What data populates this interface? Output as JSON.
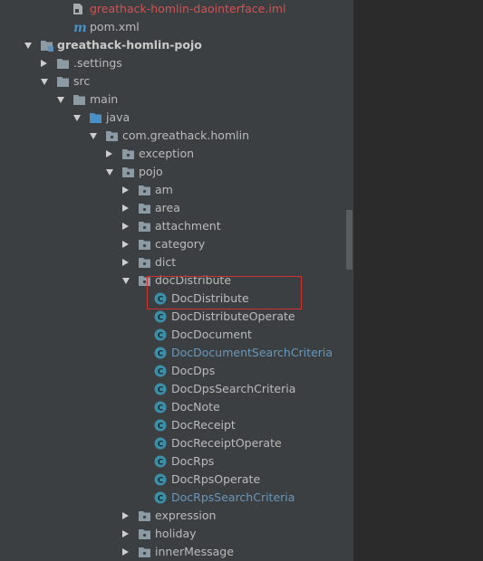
{
  "tree": {
    "rows": [
      {
        "label": "greathack-homlin-daointerface.iml",
        "icon": "iml-file-icon",
        "style": "red"
      },
      {
        "label": "pom.xml",
        "icon": "maven-icon",
        "style": "normal"
      },
      {
        "label": "greathack-homlin-pojo",
        "icon": "module-folder-icon",
        "style": "bold",
        "state": "expanded"
      },
      {
        "label": ".settings",
        "icon": "folder-icon",
        "style": "normal",
        "state": "collapsed"
      },
      {
        "label": "src",
        "icon": "folder-icon",
        "style": "normal",
        "state": "expanded"
      },
      {
        "label": "main",
        "icon": "folder-icon",
        "style": "normal",
        "state": "expanded"
      },
      {
        "label": "java",
        "icon": "source-folder-icon",
        "style": "normal",
        "state": "expanded"
      },
      {
        "label": "com.greathack.homlin",
        "icon": "package-icon",
        "style": "normal",
        "state": "expanded"
      },
      {
        "label": "exception",
        "icon": "package-icon",
        "style": "normal",
        "state": "collapsed"
      },
      {
        "label": "pojo",
        "icon": "package-icon",
        "style": "normal",
        "state": "expanded"
      },
      {
        "label": "am",
        "icon": "package-icon",
        "style": "normal",
        "state": "collapsed"
      },
      {
        "label": "area",
        "icon": "package-icon",
        "style": "normal",
        "state": "collapsed"
      },
      {
        "label": "attachment",
        "icon": "package-icon",
        "style": "normal",
        "state": "collapsed"
      },
      {
        "label": "category",
        "icon": "package-icon",
        "style": "normal",
        "state": "collapsed"
      },
      {
        "label": "dict",
        "icon": "package-icon",
        "style": "normal",
        "state": "collapsed"
      },
      {
        "label": "docDistribute",
        "icon": "package-icon",
        "style": "normal",
        "state": "expanded"
      },
      {
        "label": "DocDistribute",
        "icon": "class-icon",
        "style": "normal"
      },
      {
        "label": "DocDistributeOperate",
        "icon": "class-icon",
        "style": "normal"
      },
      {
        "label": "DocDocument",
        "icon": "class-icon",
        "style": "normal"
      },
      {
        "label": "DocDocumentSearchCriteria",
        "icon": "class-icon",
        "style": "blue"
      },
      {
        "label": "DocDps",
        "icon": "class-icon",
        "style": "normal"
      },
      {
        "label": "DocDpsSearchCriteria",
        "icon": "class-icon",
        "style": "normal"
      },
      {
        "label": "DocNote",
        "icon": "class-icon",
        "style": "normal"
      },
      {
        "label": "DocReceipt",
        "icon": "class-icon",
        "style": "normal"
      },
      {
        "label": "DocReceiptOperate",
        "icon": "class-icon",
        "style": "normal"
      },
      {
        "label": "DocRps",
        "icon": "class-icon",
        "style": "normal"
      },
      {
        "label": "DocRpsOperate",
        "icon": "class-icon",
        "style": "normal"
      },
      {
        "label": "DocRpsSearchCriteria",
        "icon": "class-icon",
        "style": "blue"
      },
      {
        "label": "expression",
        "icon": "package-icon",
        "style": "normal",
        "state": "collapsed"
      },
      {
        "label": "holiday",
        "icon": "package-icon",
        "style": "normal",
        "state": "collapsed"
      },
      {
        "label": "innerMessage",
        "icon": "package-icon",
        "style": "normal",
        "state": "collapsed"
      }
    ]
  },
  "colors": {
    "panel_bg": "#3c3f41",
    "editor_bg": "#2b2b2b",
    "text": "#bbbbbb",
    "error_text": "#d25252",
    "vcs_modified_text": "#6897bb",
    "class_icon": "#3d8fa8",
    "highlight_border": "#d03232"
  },
  "class_icon_letter": "C",
  "maven_icon_letter": "m"
}
